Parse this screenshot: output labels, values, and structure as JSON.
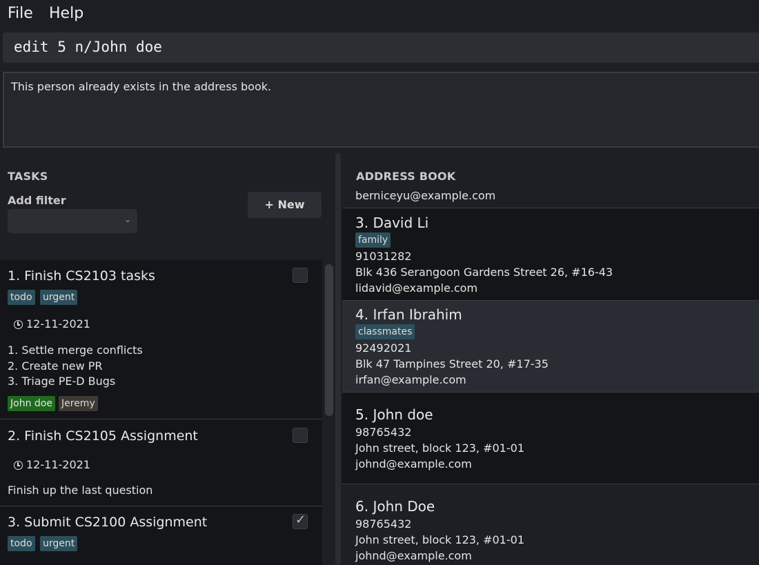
{
  "menu": {
    "file": "File",
    "help": "Help"
  },
  "command": {
    "value": "edit 5 n/John doe"
  },
  "result": {
    "message": "This person already exists in the address book."
  },
  "tasks_panel": {
    "title": "TASKS",
    "filter_label": "Add filter",
    "filter_value": "",
    "new_button": "+ New",
    "tasks": [
      {
        "title": "1.  Finish CS2103 tasks",
        "tags": [
          "todo",
          "urgent"
        ],
        "date": "12-11-2021",
        "desc": [
          "1. Settle merge conflicts",
          "2. Create new PR",
          "3. Triage PE-D Bugs"
        ],
        "people": [
          "John doe",
          "Jeremy"
        ],
        "done": false
      },
      {
        "title": "2.  Finish CS2105 Assignment",
        "date": "12-11-2021",
        "desc": [
          "Finish up the last question"
        ],
        "done": false
      },
      {
        "title": "3.  Submit CS2100 Assignment",
        "tags": [
          "todo",
          "urgent"
        ],
        "done": true
      }
    ]
  },
  "address_book": {
    "title": "ADDRESS BOOK",
    "partial_email": "berniceyu@example.com",
    "persons": [
      {
        "name": "3.  David Li",
        "tag": "family",
        "phone": "91031282",
        "address": "Blk 436 Serangoon Gardens Street 26, #16-43",
        "email": "lidavid@example.com"
      },
      {
        "name": "4.  Irfan Ibrahim",
        "tag": "classmates",
        "phone": "92492021",
        "address": "Blk 47 Tampines Street 20, #17-35",
        "email": "irfan@example.com"
      },
      {
        "name": "5.  John doe",
        "phone": "98765432",
        "address": "John street, block 123, #01-01",
        "email": "johnd@example.com"
      },
      {
        "name": "6.  John Doe",
        "phone": "98765432",
        "address": "John street, block 123, #01-01",
        "email": "johnd@example.com"
      }
    ]
  },
  "colors": {
    "background": "#1e1f24",
    "card": "#141518",
    "tag": "#2d4f5c",
    "tag_person_green": "#1f6a1f",
    "tag_person_olive": "#3d3a34",
    "selected_row": "#2a2c33"
  },
  "icons": {
    "date": "clock-icon",
    "dropdown": "chevron-down-icon",
    "done": "check-icon"
  }
}
